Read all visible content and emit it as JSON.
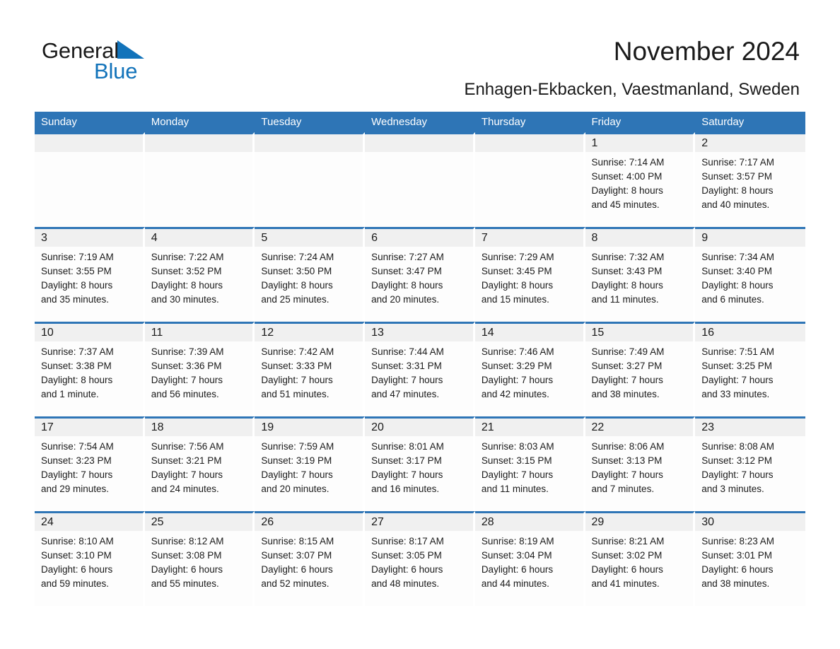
{
  "brand": {
    "name_top": "General",
    "name_bottom": "Blue",
    "triangle_color": "#1273ba"
  },
  "header": {
    "title": "November 2024",
    "subtitle": "Enhagen-Ekbacken, Vaestmanland, Sweden"
  },
  "theme": {
    "header_blue": "#2e75b6",
    "daynum_gray": "#f0f0f0",
    "cell_white": "#fdfdfd",
    "text_black": "#1a1a1a"
  },
  "calendar": {
    "weekday_headers": [
      "Sunday",
      "Monday",
      "Tuesday",
      "Wednesday",
      "Thursday",
      "Friday",
      "Saturday"
    ],
    "weeks": [
      [
        {
          "day": "",
          "lines": []
        },
        {
          "day": "",
          "lines": []
        },
        {
          "day": "",
          "lines": []
        },
        {
          "day": "",
          "lines": []
        },
        {
          "day": "",
          "lines": []
        },
        {
          "day": "1",
          "lines": [
            "Sunrise: 7:14 AM",
            "Sunset: 4:00 PM",
            "Daylight: 8 hours",
            "and 45 minutes."
          ]
        },
        {
          "day": "2",
          "lines": [
            "Sunrise: 7:17 AM",
            "Sunset: 3:57 PM",
            "Daylight: 8 hours",
            "and 40 minutes."
          ]
        }
      ],
      [
        {
          "day": "3",
          "lines": [
            "Sunrise: 7:19 AM",
            "Sunset: 3:55 PM",
            "Daylight: 8 hours",
            "and 35 minutes."
          ]
        },
        {
          "day": "4",
          "lines": [
            "Sunrise: 7:22 AM",
            "Sunset: 3:52 PM",
            "Daylight: 8 hours",
            "and 30 minutes."
          ]
        },
        {
          "day": "5",
          "lines": [
            "Sunrise: 7:24 AM",
            "Sunset: 3:50 PM",
            "Daylight: 8 hours",
            "and 25 minutes."
          ]
        },
        {
          "day": "6",
          "lines": [
            "Sunrise: 7:27 AM",
            "Sunset: 3:47 PM",
            "Daylight: 8 hours",
            "and 20 minutes."
          ]
        },
        {
          "day": "7",
          "lines": [
            "Sunrise: 7:29 AM",
            "Sunset: 3:45 PM",
            "Daylight: 8 hours",
            "and 15 minutes."
          ]
        },
        {
          "day": "8",
          "lines": [
            "Sunrise: 7:32 AM",
            "Sunset: 3:43 PM",
            "Daylight: 8 hours",
            "and 11 minutes."
          ]
        },
        {
          "day": "9",
          "lines": [
            "Sunrise: 7:34 AM",
            "Sunset: 3:40 PM",
            "Daylight: 8 hours",
            "and 6 minutes."
          ]
        }
      ],
      [
        {
          "day": "10",
          "lines": [
            "Sunrise: 7:37 AM",
            "Sunset: 3:38 PM",
            "Daylight: 8 hours",
            "and 1 minute."
          ]
        },
        {
          "day": "11",
          "lines": [
            "Sunrise: 7:39 AM",
            "Sunset: 3:36 PM",
            "Daylight: 7 hours",
            "and 56 minutes."
          ]
        },
        {
          "day": "12",
          "lines": [
            "Sunrise: 7:42 AM",
            "Sunset: 3:33 PM",
            "Daylight: 7 hours",
            "and 51 minutes."
          ]
        },
        {
          "day": "13",
          "lines": [
            "Sunrise: 7:44 AM",
            "Sunset: 3:31 PM",
            "Daylight: 7 hours",
            "and 47 minutes."
          ]
        },
        {
          "day": "14",
          "lines": [
            "Sunrise: 7:46 AM",
            "Sunset: 3:29 PM",
            "Daylight: 7 hours",
            "and 42 minutes."
          ]
        },
        {
          "day": "15",
          "lines": [
            "Sunrise: 7:49 AM",
            "Sunset: 3:27 PM",
            "Daylight: 7 hours",
            "and 38 minutes."
          ]
        },
        {
          "day": "16",
          "lines": [
            "Sunrise: 7:51 AM",
            "Sunset: 3:25 PM",
            "Daylight: 7 hours",
            "and 33 minutes."
          ]
        }
      ],
      [
        {
          "day": "17",
          "lines": [
            "Sunrise: 7:54 AM",
            "Sunset: 3:23 PM",
            "Daylight: 7 hours",
            "and 29 minutes."
          ]
        },
        {
          "day": "18",
          "lines": [
            "Sunrise: 7:56 AM",
            "Sunset: 3:21 PM",
            "Daylight: 7 hours",
            "and 24 minutes."
          ]
        },
        {
          "day": "19",
          "lines": [
            "Sunrise: 7:59 AM",
            "Sunset: 3:19 PM",
            "Daylight: 7 hours",
            "and 20 minutes."
          ]
        },
        {
          "day": "20",
          "lines": [
            "Sunrise: 8:01 AM",
            "Sunset: 3:17 PM",
            "Daylight: 7 hours",
            "and 16 minutes."
          ]
        },
        {
          "day": "21",
          "lines": [
            "Sunrise: 8:03 AM",
            "Sunset: 3:15 PM",
            "Daylight: 7 hours",
            "and 11 minutes."
          ]
        },
        {
          "day": "22",
          "lines": [
            "Sunrise: 8:06 AM",
            "Sunset: 3:13 PM",
            "Daylight: 7 hours",
            "and 7 minutes."
          ]
        },
        {
          "day": "23",
          "lines": [
            "Sunrise: 8:08 AM",
            "Sunset: 3:12 PM",
            "Daylight: 7 hours",
            "and 3 minutes."
          ]
        }
      ],
      [
        {
          "day": "24",
          "lines": [
            "Sunrise: 8:10 AM",
            "Sunset: 3:10 PM",
            "Daylight: 6 hours",
            "and 59 minutes."
          ]
        },
        {
          "day": "25",
          "lines": [
            "Sunrise: 8:12 AM",
            "Sunset: 3:08 PM",
            "Daylight: 6 hours",
            "and 55 minutes."
          ]
        },
        {
          "day": "26",
          "lines": [
            "Sunrise: 8:15 AM",
            "Sunset: 3:07 PM",
            "Daylight: 6 hours",
            "and 52 minutes."
          ]
        },
        {
          "day": "27",
          "lines": [
            "Sunrise: 8:17 AM",
            "Sunset: 3:05 PM",
            "Daylight: 6 hours",
            "and 48 minutes."
          ]
        },
        {
          "day": "28",
          "lines": [
            "Sunrise: 8:19 AM",
            "Sunset: 3:04 PM",
            "Daylight: 6 hours",
            "and 44 minutes."
          ]
        },
        {
          "day": "29",
          "lines": [
            "Sunrise: 8:21 AM",
            "Sunset: 3:02 PM",
            "Daylight: 6 hours",
            "and 41 minutes."
          ]
        },
        {
          "day": "30",
          "lines": [
            "Sunrise: 8:23 AM",
            "Sunset: 3:01 PM",
            "Daylight: 6 hours",
            "and 38 minutes."
          ]
        }
      ]
    ]
  }
}
